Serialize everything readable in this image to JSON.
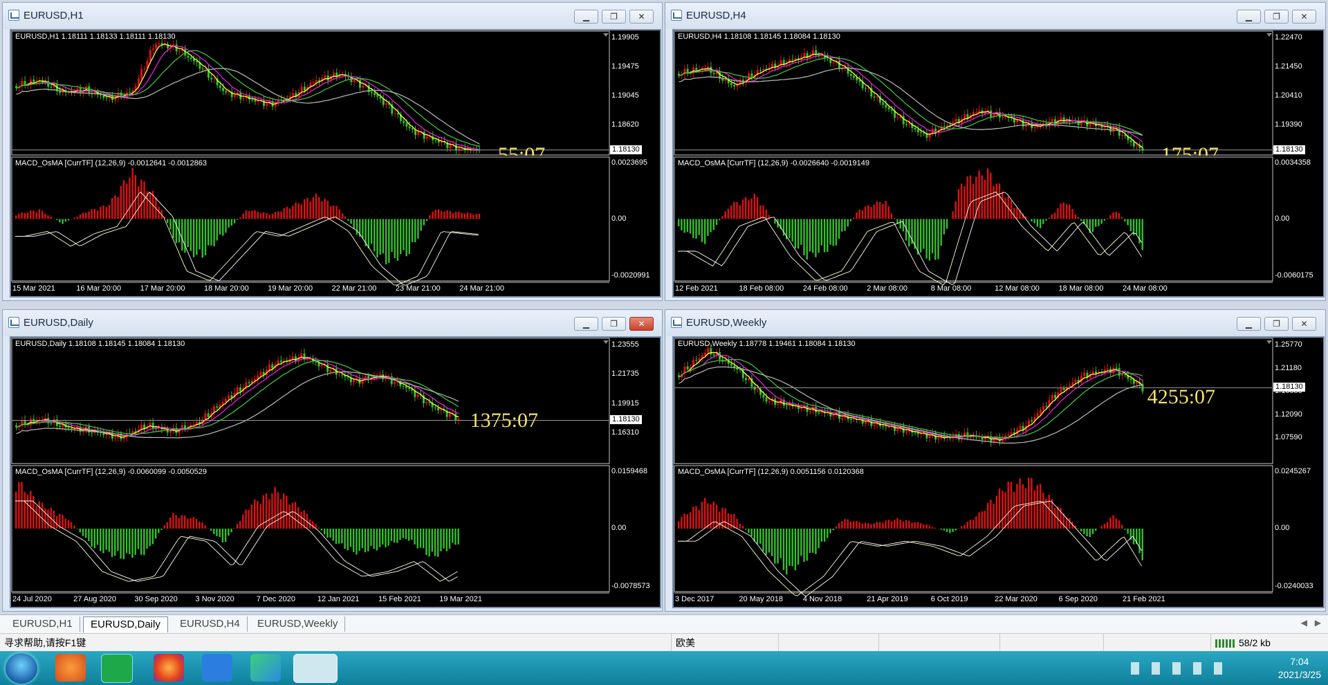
{
  "windows": {
    "h1": {
      "title": "EURUSD,H1",
      "header": "EURUSD,H1  1.18111 1.18133 1.18111 1.18130",
      "price_ticks": [
        "1.19905",
        "1.19475",
        "1.19045",
        "1.18620"
      ],
      "current_price": "1.18130",
      "timer": "55:07",
      "macd_header": "MACD_OsMA [CurrTF] (12,26,9) -0.0012641 -0.0012863",
      "macd_ticks": [
        "0.0023695",
        "0.00",
        "-0.0020991"
      ],
      "time_ticks": [
        "15 Mar 2021",
        "16 Mar 20:00",
        "17 Mar 20:00",
        "18 Mar 20:00",
        "19 Mar 20:00",
        "22 Mar 21:00",
        "23 Mar 21:00",
        "24 Mar 21:00"
      ]
    },
    "h4": {
      "title": "EURUSD,H4",
      "header": "EURUSD,H4  1.18108 1.18145 1.18084 1.18130",
      "price_ticks": [
        "1.22470",
        "1.21450",
        "1.20410",
        "1.19390"
      ],
      "current_price": "1.18130",
      "timer": "175:07",
      "macd_header": "MACD_OsMA [CurrTF] (12,26,9) -0.0026640 -0.0019149",
      "macd_ticks": [
        "0.0034358",
        "0.00",
        "-0.0060175"
      ],
      "time_ticks": [
        "12 Feb 2021",
        "18 Feb 08:00",
        "24 Feb 08:00",
        "2 Mar 08:00",
        "8 Mar 08:00",
        "12 Mar 08:00",
        "18 Mar 08:00",
        "24 Mar 08:00"
      ]
    },
    "daily": {
      "title": "EURUSD,Daily",
      "header": "EURUSD,Daily  1.18108 1.18145 1.18084 1.18130",
      "price_ticks": [
        "1.23555",
        "1.21735",
        "1.19915",
        "1.16310"
      ],
      "current_price": "1.18130",
      "timer": "1375:07",
      "macd_header": "MACD_OsMA [CurrTF] (12,26,9) -0.0060099 -0.0050529",
      "macd_ticks": [
        "0.0159468",
        "0.00",
        "-0.0078573"
      ],
      "time_ticks": [
        "24 Jul 2020",
        "27 Aug 2020",
        "30 Sep 2020",
        "3 Nov 2020",
        "7 Dec 2020",
        "12 Jan 2021",
        "15 Feb 2021",
        "19 Mar 2021"
      ]
    },
    "weekly": {
      "title": "EURUSD,Weekly",
      "header": "EURUSD,Weekly  1.18778 1.19461 1.18084 1.18130",
      "price_ticks": [
        "1.25770",
        "1.21180",
        "1.16680",
        "1.12090",
        "1.07590"
      ],
      "current_price": "1.18130",
      "timer": "4255:07",
      "macd_header": "MACD_OsMA [CurrTF] (12,26,9) 0.0051156 0.0120368",
      "macd_ticks": [
        "0.0245267",
        "0.00",
        "-0.0240033"
      ],
      "time_ticks": [
        "3 Dec 2017",
        "20 May 2018",
        "4 Nov 2018",
        "21 Apr 2019",
        "6 Oct 2019",
        "22 Mar 2020",
        "6 Sep 2020",
        "21 Feb 2021"
      ]
    }
  },
  "tabs": [
    "EURUSD,H1",
    "EURUSD,Daily",
    "EURUSD,H4",
    "EURUSD,Weekly"
  ],
  "selected_tab": "EURUSD,Daily",
  "status": {
    "help": "寻求帮助,请按F1键",
    "profile": "欧美",
    "traffic": "58/2 kb"
  },
  "clock": {
    "time": "7:04",
    "date": "2021/3/25"
  },
  "colors": {
    "up": "#e01010",
    "down": "#33c12a",
    "ma_yellow": "#ffff40",
    "ma_magenta": "#e020e0",
    "ma_green": "#40c040",
    "ma_gray": "#b0b0b0",
    "timer": "#f6e36a"
  },
  "icons": {
    "minimize": "minimize-icon",
    "restore": "restore-icon",
    "close": "close-icon"
  },
  "chart_data": [
    {
      "type": "candlestick",
      "title": "EURUSD,H1",
      "series": [
        {
          "name": "MACD_OsMA"
        }
      ],
      "ylim": [
        1.1805,
        1.1995
      ]
    },
    {
      "type": "candlestick",
      "title": "EURUSD,H4",
      "ylim": [
        1.1815,
        1.2255
      ]
    },
    {
      "type": "candlestick",
      "title": "EURUSD,Daily",
      "ylim": [
        1.158,
        1.238
      ]
    },
    {
      "type": "candlestick",
      "title": "EURUSD,Weekly",
      "ylim": [
        1.068,
        1.262
      ]
    }
  ]
}
